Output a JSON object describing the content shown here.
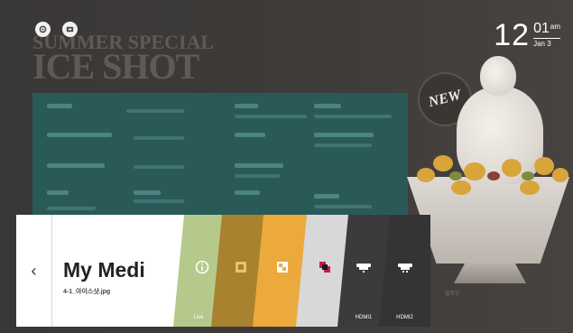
{
  "top_bar": {
    "settings_icon": "gear-icon",
    "input_icon": "input-icon",
    "clock": {
      "hour": "12",
      "minute": "01",
      "ampm": "am",
      "date": "Jan 3"
    }
  },
  "poster": {
    "title_line1": "SUMMER SPECIAL",
    "title_line2": "ICE SHOT",
    "badge": "NEW",
    "cup_note": "밀로우"
  },
  "launcher": {
    "back_icon": "chevron-left-icon",
    "recent": {
      "title": "My Medi",
      "filename": "4-1_아이스샷.jpg"
    },
    "cards": [
      {
        "id": "live",
        "icon": "info-icon",
        "label": "Live",
        "color": "#b6c98c"
      },
      {
        "id": "app2",
        "icon": "app-icon",
        "label": "",
        "color": "#a8822f"
      },
      {
        "id": "app3",
        "icon": "app-icon",
        "label": "",
        "color": "#ecaa3c"
      },
      {
        "id": "lg-store",
        "icon": "store-icon",
        "label": "",
        "color": "#d8d8d8"
      },
      {
        "id": "hdmi1",
        "icon": "hdmi-icon",
        "label": "HDMI1",
        "color": "#3b3b3b"
      },
      {
        "id": "hdmi2",
        "icon": "hdmi-icon",
        "label": "HDMI2",
        "color": "#343434"
      }
    ]
  }
}
